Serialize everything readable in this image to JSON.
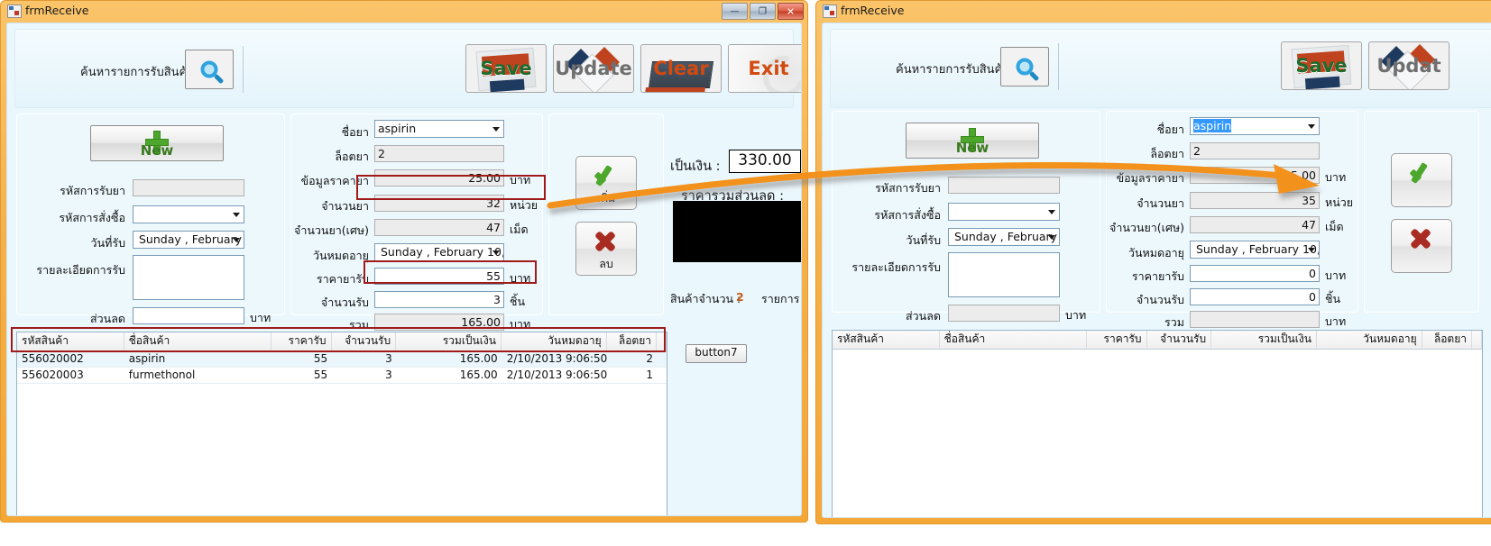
{
  "window_left": {
    "title": "frmReceive",
    "buttons": {
      "minimize": "—",
      "maximize": "❐",
      "close": "✕"
    }
  },
  "window_right": {
    "title": "frmReceive"
  },
  "toolbar": {
    "search_label": "ค้นหารายการรับสินค้า",
    "search_icon": "search-icon",
    "save_label": "Save",
    "update_label": "Update",
    "clear_label": "Clear",
    "exit_label": "Exit"
  },
  "left_panel": {
    "new_button": "New",
    "fields": [
      {
        "label": "รหัสการรับยา",
        "value": "",
        "type": "textbox-readonly"
      },
      {
        "label": "รหัสการสั่งซื้อ",
        "value": "",
        "type": "combo"
      },
      {
        "label": "วันที่รับ",
        "value": "Sunday   ,  February",
        "type": "datepicker"
      },
      {
        "label": "รายละเอียดการรับ",
        "value": "",
        "type": "multiline"
      },
      {
        "label": "ส่วนลด",
        "value": "",
        "type": "textbox",
        "unit": "บาท"
      }
    ]
  },
  "mid_panel": {
    "fields": [
      {
        "label": "ชื่อยา",
        "value": "aspirin",
        "type": "combo",
        "unit": ""
      },
      {
        "label": "ล็อตยา",
        "value": "2",
        "type": "textbox-readonly",
        "unit": ""
      },
      {
        "label": "ข้อมูลราคายา",
        "value": "25.00",
        "type": "textbox-readonly",
        "unit": "บาท"
      },
      {
        "label": "จำนวนยา",
        "value": "32",
        "type": "textbox-readonly",
        "unit": "หน่วย",
        "highlight": true
      },
      {
        "label": "จำนวนยา(เศษ)",
        "value": "47",
        "type": "textbox-readonly",
        "unit": "เม็ด"
      },
      {
        "label": "วันหมดอายุ",
        "value": "Sunday   ,  February  10,",
        "type": "datepicker",
        "unit": ""
      },
      {
        "label": "ราคายารับ",
        "value": "55",
        "type": "textbox",
        "unit": "บาท"
      },
      {
        "label": "จำนวนรับ",
        "value": "3",
        "type": "textbox",
        "unit": "ชิ้น",
        "highlight": true
      },
      {
        "label": "รวม",
        "value": "165.00",
        "type": "textbox-readonly",
        "unit": "บาท"
      }
    ]
  },
  "action_panel": {
    "add_label": "เพิ่ม",
    "delete_label": "ลบ"
  },
  "summary": {
    "money_label": "เป็นเงิน :",
    "money_value": "330.00",
    "discount_total_label": "ราคารวมส่วนลด :",
    "discount_total_value": "",
    "count_label": "สินค้าจำนวน :",
    "count_value": "2",
    "count_unit": "รายการ"
  },
  "grid": {
    "columns": [
      "รหัสสินค้า",
      "ชื่อสินค้า",
      "ราคารับ",
      "จำนวนรับ",
      "รวมเป็นเงิน",
      "วันหมดอายุ",
      "ล็อตยา",
      ""
    ],
    "rows": [
      {
        "code": "556020002",
        "name": "aspirin",
        "price": "55",
        "qty": "3",
        "total": "165.00",
        "expiry": "2/10/2013 9:06:50 ...",
        "lot": "2",
        "extra": ""
      },
      {
        "code": "556020003",
        "name": "furmethonol",
        "price": "55",
        "qty": "3",
        "total": "165.00",
        "expiry": "2/10/2013 9:06:50 ...",
        "lot": "1",
        "extra": ""
      }
    ]
  },
  "misc": {
    "button7": "button7"
  },
  "right_form": {
    "search_label": "ค้นหารายการรับสินค้า",
    "new_button": "New",
    "save_label": "Save",
    "update_label": "Updat",
    "left_fields": [
      {
        "label": "รหัสการรับยา",
        "value": "",
        "type": "textbox-readonly"
      },
      {
        "label": "รหัสการสั่งซื้อ",
        "value": "",
        "type": "combo"
      },
      {
        "label": "วันที่รับ",
        "value": "Sunday   ,  February",
        "type": "datepicker"
      },
      {
        "label": "รายละเอียดการรับ",
        "value": "",
        "type": "multiline"
      },
      {
        "label": "ส่วนลด",
        "value": "",
        "type": "textbox",
        "unit": "บาท"
      }
    ],
    "mid_fields": [
      {
        "label": "ชื่อยา",
        "value": "aspirin",
        "type": "combo-selected",
        "unit": ""
      },
      {
        "label": "ล็อตยา",
        "value": "2",
        "type": "textbox-readonly",
        "unit": ""
      },
      {
        "label": "ข้อมูลราคายา",
        "value": "25.00",
        "type": "textbox-readonly",
        "unit": "บาท"
      },
      {
        "label": "จำนวนยา",
        "value": "35",
        "type": "textbox-readonly",
        "unit": "หน่วย"
      },
      {
        "label": "จำนวนยา(เศษ)",
        "value": "47",
        "type": "textbox-readonly",
        "unit": "เม็ด"
      },
      {
        "label": "วันหมดอายุ",
        "value": "Sunday   ,  February  10,",
        "type": "datepicker",
        "unit": ""
      },
      {
        "label": "ราคายารับ",
        "value": "0",
        "type": "textbox",
        "unit": "บาท"
      },
      {
        "label": "จำนวนรับ",
        "value": "0",
        "type": "textbox",
        "unit": "ชิ้น"
      },
      {
        "label": "รวม",
        "value": "",
        "type": "textbox-readonly",
        "unit": "บาท"
      }
    ],
    "grid_columns": [
      "รหัสสินค้า",
      "ชื่อสินค้า",
      "ราคารับ",
      "จำนวนรับ",
      "รวมเป็นเงิน",
      "วันหมดอายุ",
      "ล็อตยา"
    ]
  },
  "colors": {
    "titlebar": "#f5a736",
    "client": "#eaf7fd",
    "panel": "#a9ddf5",
    "accent_red": "#a01a1a",
    "arrow": "#f2921d",
    "highlight_blue": "#3399ff"
  }
}
